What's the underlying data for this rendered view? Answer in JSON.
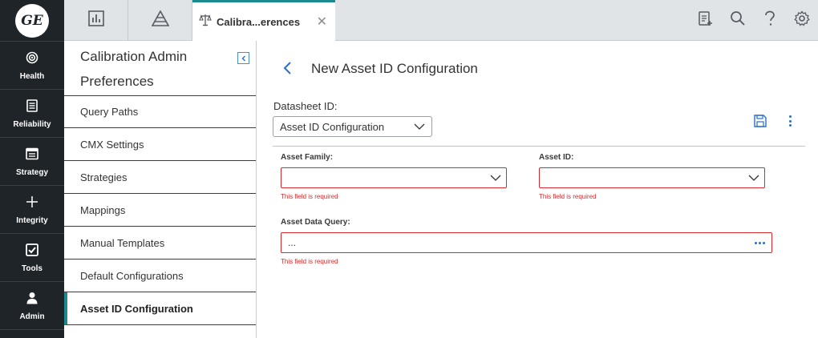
{
  "logo": {
    "text": "GE"
  },
  "leftnav": {
    "items": [
      {
        "label": "Health",
        "icon": "target-icon"
      },
      {
        "label": "Reliability",
        "icon": "document-icon"
      },
      {
        "label": "Strategy",
        "icon": "calendar-icon"
      },
      {
        "label": "Integrity",
        "icon": "plus-icon"
      },
      {
        "label": "Tools",
        "icon": "checkbox-icon"
      },
      {
        "label": "Admin",
        "icon": "user-icon"
      }
    ]
  },
  "tabs": {
    "active_label": "Calibra...erences",
    "icons": [
      "dashboard-icon",
      "pyramid-icon"
    ]
  },
  "toolbar_icons": [
    "clipboard-add-icon",
    "search-icon",
    "help-icon",
    "gear-icon"
  ],
  "side": {
    "title": "Calibration Admin Preferences",
    "items": [
      {
        "label": "Query Paths"
      },
      {
        "label": "CMX Settings"
      },
      {
        "label": "Strategies"
      },
      {
        "label": "Mappings"
      },
      {
        "label": "Manual Templates"
      },
      {
        "label": "Default Configurations"
      },
      {
        "label": "Asset ID Configuration",
        "active": true
      }
    ]
  },
  "main": {
    "title": "New Asset ID Configuration",
    "datasheet_label": "Datasheet ID:",
    "datasheet_value": "Asset ID Configuration",
    "fields": {
      "asset_family_label": "Asset Family:",
      "asset_id_label": "Asset ID:",
      "asset_query_label": "Asset Data Query:",
      "asset_query_value": "...",
      "required_msg": "This field is required"
    }
  },
  "colors": {
    "nav_bg": "#1f2429",
    "accent_teal": "#1a8a8f",
    "link_blue": "#2b6fcb",
    "error_red": "#d9292b"
  }
}
